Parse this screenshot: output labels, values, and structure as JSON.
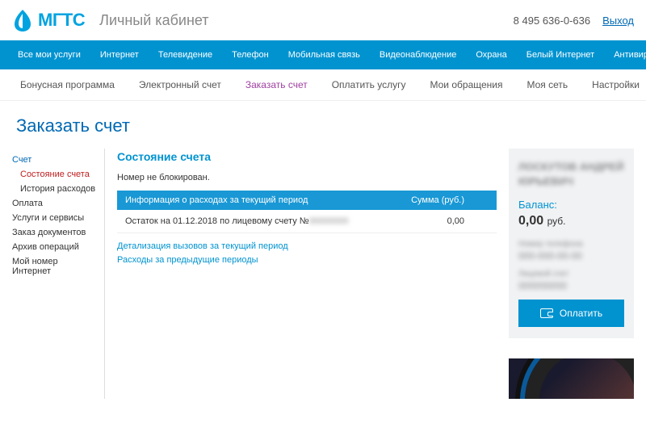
{
  "header": {
    "brand": "МГТС",
    "title": "Личный кабинет",
    "phone": "8 495 636-0-636",
    "logout": "Выход"
  },
  "nav_primary": [
    "Все мои услуги",
    "Интернет",
    "Телевидение",
    "Телефон",
    "Мобильная связь",
    "Видеонаблюдение",
    "Охрана",
    "Белый Интернет",
    "Антивирус"
  ],
  "nav_secondary": [
    {
      "label": "Бонусная программа",
      "active": false
    },
    {
      "label": "Электронный счет",
      "active": false
    },
    {
      "label": "Заказать счет",
      "active": true
    },
    {
      "label": "Оплатить услугу",
      "active": false
    },
    {
      "label": "Мои обращения",
      "active": false
    },
    {
      "label": "Моя сеть",
      "active": false
    },
    {
      "label": "Настройки",
      "active": false
    }
  ],
  "page_title": "Заказать счет",
  "sidebar": [
    {
      "label": "Счет",
      "heading": true
    },
    {
      "label": "Состояние счета",
      "indented": true,
      "active": true
    },
    {
      "label": "История расходов",
      "indented": true
    },
    {
      "label": "Оплата"
    },
    {
      "label": "Услуги и сервисы"
    },
    {
      "label": "Заказ документов"
    },
    {
      "label": "Архив операций"
    },
    {
      "label": "Мой номер Интернет"
    }
  ],
  "main": {
    "section_title": "Состояние счета",
    "status": "Номер не блокирован.",
    "table": {
      "headers": [
        "Информация о расходах за текущий период",
        "Сумма (руб.)"
      ],
      "rows": [
        {
          "label_prefix": "Остаток на 01.12.2018 по лицевому счету №",
          "label_blur": "00000000",
          "value": "0,00"
        }
      ]
    },
    "links": [
      "Детализация вызовов за текущий период",
      "Расходы за предыдущие периоды"
    ]
  },
  "right_panel": {
    "name_blur": "ЛОСКУТОВ АНДРЕЙ ЮРЬЕВИЧ",
    "balance_label": "Баланс:",
    "balance_value": "0,00",
    "currency": "руб.",
    "phone_label_blur": "Номер телефона",
    "phone_value_blur": "000-000-00-00",
    "acct_label_blur": "Лицевой счет",
    "acct_value_blur": "000000000",
    "pay_button": "Оплатить"
  }
}
